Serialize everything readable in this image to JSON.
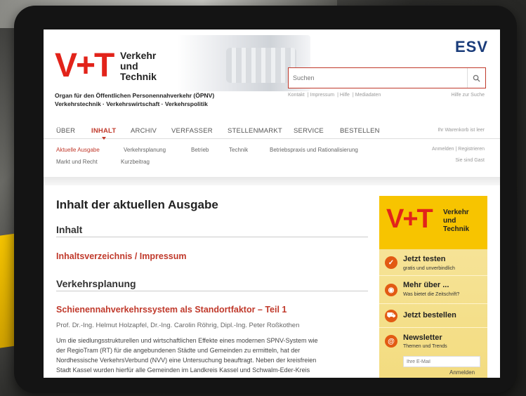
{
  "header": {
    "logo_mark": "V+T",
    "logo_lines": [
      "Verkehr",
      "und",
      "Technik"
    ],
    "tagline_1": "Organ für den Öffentlichen Personennahverkehr (ÖPNV)",
    "tagline_2": "Verkehrstechnik · Verkehrswirtschaft · Verkehrspolitik",
    "publisher_logo": "ESV",
    "search_placeholder": "Suchen",
    "top_links": [
      "Kontakt",
      "Impressum",
      "Hilfe",
      "Mediadaten"
    ],
    "search_help": "Hilfe zur Suche"
  },
  "nav": {
    "items": [
      "ÜBER",
      "INHALT",
      "ARCHIV",
      "VERFASSER",
      "STELLENMARKT",
      "SERVICE",
      "BESTELLEN"
    ],
    "active": "INHALT",
    "cart": "Ihr Warenkorb ist leer"
  },
  "subnav": {
    "row1": [
      "Aktuelle Ausgabe",
      "Verkehrsplanung",
      "Betrieb",
      "Technik",
      "Betriebspraxis und Rationalisierung"
    ],
    "row2": [
      "Markt und Recht",
      "Kurzbeitrag"
    ],
    "active": "Aktuelle Ausgabe",
    "login": "Anmelden | Registrieren",
    "guest": "Sie sind Gast"
  },
  "main": {
    "title": "Inhalt der aktuellen Ausgabe",
    "section_inhalt": "Inhalt",
    "toc_link": "Inhaltsverzeichnis / Impressum",
    "section_planning": "Verkehrsplanung",
    "article_title": "Schienennahverkehrssystem als Standortfaktor – Teil 1",
    "article_authors": "Prof. Dr.-Ing. Helmut Holzapfel, Dr.-Ing. Carolin Röhrig, Dipl.-Ing. Peter Roßkothen",
    "article_abstract_lines": [
      "Um die siedlungsstrukturellen und wirtschaftlichen Effekte eines modernen SPNV-System wie",
      "der RegioTram (RT) für die angebundenen Städte und Gemeinden zu ermitteln, hat der",
      "Nordhessische VerkehrsVerbund (NVV) eine Untersuchung beauftragt. Neben der kreisfreien",
      "Stadt Kassel wurden hierfür alle Gemeinden im Landkreis Kassel und Schwalm-Eder-Kreis"
    ]
  },
  "sidebar": {
    "logo_mark": "V+T",
    "logo_lines": [
      "Verkehr",
      "und",
      "Technik"
    ],
    "items": [
      {
        "label": "Jetzt testen",
        "sub": "gratis und unverbindlich",
        "icon": "check-icon"
      },
      {
        "label": "Mehr über ...",
        "sub": "Was bietet die Zeitschrift?",
        "icon": "eye-icon"
      },
      {
        "label": "Jetzt bestellen",
        "sub": "",
        "icon": "cart-icon"
      },
      {
        "label": "Newsletter",
        "sub": "Themen und Trends",
        "icon": "at-icon"
      }
    ],
    "email_placeholder": "Ihre E-Mail",
    "subscribe_label": "Anmelden"
  },
  "colors": {
    "brand_red": "#e2231a",
    "link_red": "#c0392b",
    "sidebar_yellow": "#f7c400",
    "icon_orange": "#e25a13",
    "esv_blue": "#1a3c7a"
  }
}
